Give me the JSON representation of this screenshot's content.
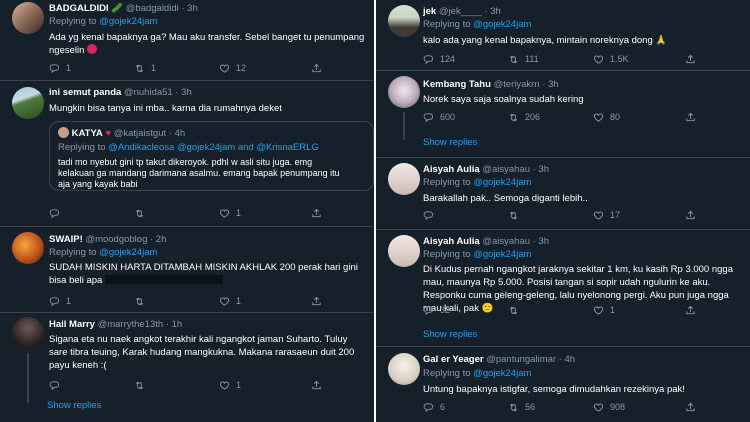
{
  "left": {
    "tweets": [
      {
        "name": "BADGALDIDI",
        "emoji": "🥒",
        "handle": "@badgaldidi",
        "time": "· 3h",
        "replying_prefix": "Replying to",
        "replying_to": "@gojek24jam",
        "text_1": "Ada yg kenal bapaknya ga? Mau aku transfer. Sebel banget tu penumpang",
        "text_2": "ngeselin",
        "reply_count": "1",
        "retweet_count": "1",
        "like_count": "12"
      },
      {
        "name": "ini semut panda",
        "handle": "@nuhida51",
        "time": "· 3h",
        "text": "Mungkin bisa tanya ini mba.. karna dia rumahnya deket",
        "quote": {
          "name": "KATYA",
          "handle": "@katjaistgut",
          "time": "· 4h",
          "replying_prefix": "Replying to",
          "replying_to": "@Andikacleosa @gojek24jam and @KrisnaERLG",
          "text_1": "tadi mo nyebut gini tp takut dikeroyok. pdhl w asli situ juga. emg",
          "text_2": "kelakuan ga mandang darimana asalmu. emang bapak penumpang itu",
          "text_3": "aja yang kayak babi"
        },
        "reply_count": "",
        "retweet_count": "",
        "like_count": "1"
      },
      {
        "name": "SWAIP!",
        "handle": "@moodgoblog",
        "time": "· 2h",
        "replying_prefix": "Replying to",
        "replying_to": "@gojek24jam",
        "text_1": "SUDAH MISKIN HARTA DITAMBAH MISKIN AKHLAK 200 perak hari gini",
        "text_2": "bisa beli apa",
        "reply_count": "1",
        "retweet_count": "",
        "like_count": "1"
      },
      {
        "name": "Hail Marry",
        "handle": "@marrythe13th",
        "time": "· 1h",
        "text_1": "Sigana eta nu naek angkot terakhir kali ngangkot jaman Suharto. Tuluy",
        "text_2": "sare tibra teuing, Karak hudang mangkukna. Makana rarasaeun duit 200",
        "text_3": "payu keneh :(",
        "reply_count": "",
        "retweet_count": "",
        "like_count": "1"
      }
    ],
    "show_replies": "Show replies"
  },
  "right": {
    "tweets": [
      {
        "name": "jek",
        "handle": "@jek____",
        "time": "· 3h",
        "replying_prefix": "Replying to",
        "replying_to": "@gojek24jam",
        "text": "kalo ada yang kenal bapaknya, mintain noreknya dong 🙏",
        "reply_count": "124",
        "retweet_count": "111",
        "like_count": "1.5K"
      },
      {
        "name": "Kembang Tahu",
        "handle": "@teriyakrn",
        "time": "· 3h",
        "text": "Norek saya saja soalnya sudah kering",
        "reply_count": "600",
        "retweet_count": "206",
        "like_count": "80"
      },
      {
        "name": "Aisyah Aulia",
        "handle": "@aisyahau",
        "time": "· 3h",
        "replying_prefix": "Replying to",
        "replying_to": "@gojek24jam",
        "text": "Barakallah pak.. Semoga diganti lebih..",
        "reply_count": "",
        "retweet_count": "",
        "like_count": "17"
      },
      {
        "name": "Aisyah Aulia",
        "handle": "@aisyahau",
        "time": "· 3h",
        "replying_prefix": "Replying to",
        "replying_to": "@gojek24jam",
        "text_1": "Di Kudus pernah ngangkot jaraknya sekitar 1 km, ku kasih Rp 3.000 ngga",
        "text_2": "mau, maunya Rp 5.000. Posisi tangan si sopir udah ngulurin ke aku.",
        "text_3": "Responku cuma geleng-geleng, lalu nyelonong pergi. Aku pun juga ngga",
        "text_4": "mau kali, pak 🙁",
        "reply_count": "32",
        "retweet_count": "",
        "like_count": "1"
      },
      {
        "name": "Gal er Yeager",
        "handle": "@pantungalimar",
        "time": "· 4h",
        "replying_prefix": "Replying to",
        "replying_to": "@gojek24jam",
        "text": "Untung bapaknya istigfar, semoga dimudahkan rezekinya pak!",
        "reply_count": "6",
        "retweet_count": "56",
        "like_count": "908"
      }
    ],
    "show_replies_1": "Show replies",
    "show_replies_2": "Show replies",
    "show_replies_3": "Show replies"
  },
  "colors": {
    "background": "#15202b",
    "text": "#ffffff",
    "muted": "#8899a6",
    "accent": "#1da1f2",
    "border": "#38444d",
    "red": "#e0245e"
  },
  "icons": [
    "reply-icon",
    "retweet-icon",
    "like-icon",
    "share-icon",
    "angry-face-icon",
    "red-heart-icon",
    "cucumber-icon"
  ]
}
